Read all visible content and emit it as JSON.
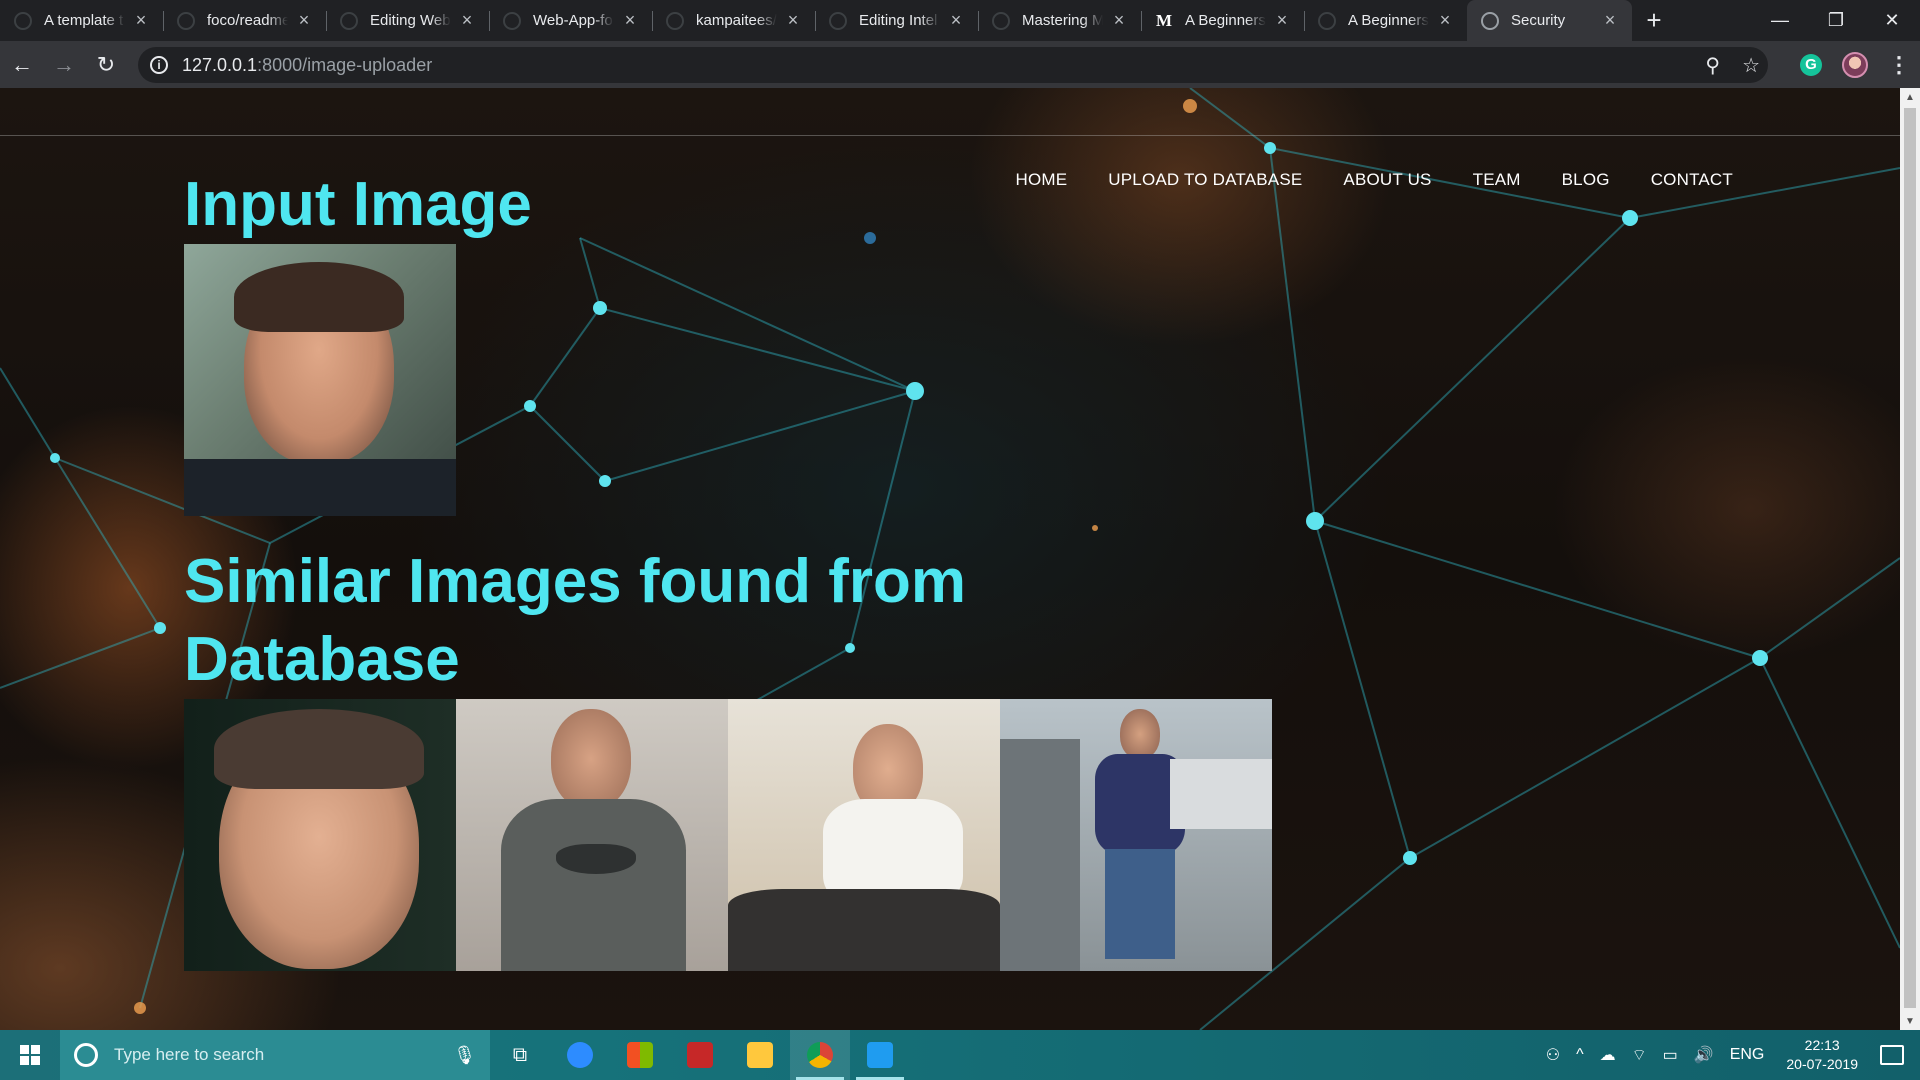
{
  "browser": {
    "tabs": [
      {
        "title": "A template t",
        "favicon": "github-icon"
      },
      {
        "title": "foco/readme",
        "favicon": "github-icon"
      },
      {
        "title": "Editing Web",
        "favicon": "github-icon"
      },
      {
        "title": "Web-App-fo",
        "favicon": "github-icon"
      },
      {
        "title": "kampaitees/",
        "favicon": "github-icon"
      },
      {
        "title": "Editing Intel",
        "favicon": "github-icon"
      },
      {
        "title": "Mastering M",
        "favicon": "github-icon"
      },
      {
        "title": "A Beginners",
        "favicon": "medium-icon"
      },
      {
        "title": "A Beginners",
        "favicon": "github-icon"
      },
      {
        "title": "Security",
        "favicon": "globe-icon",
        "active": true
      }
    ],
    "url_host": "127.0.0.1",
    "url_path": ":8000/image-uploader"
  },
  "site": {
    "nav": [
      "HOME",
      "UPLOAD TO DATABASE",
      "ABOUT US",
      "TEAM",
      "BLOG",
      "CONTACT"
    ],
    "input_heading": "Input Image",
    "similar_heading": "Similar Images found from Database"
  },
  "taskbar": {
    "search_placeholder": "Type here to search",
    "language": "ENG",
    "time": "22:13",
    "date": "20-07-2019"
  },
  "colors": {
    "heading": "#4fe6f0",
    "nav_text": "#ffffff",
    "taskbar": "#16727a"
  }
}
